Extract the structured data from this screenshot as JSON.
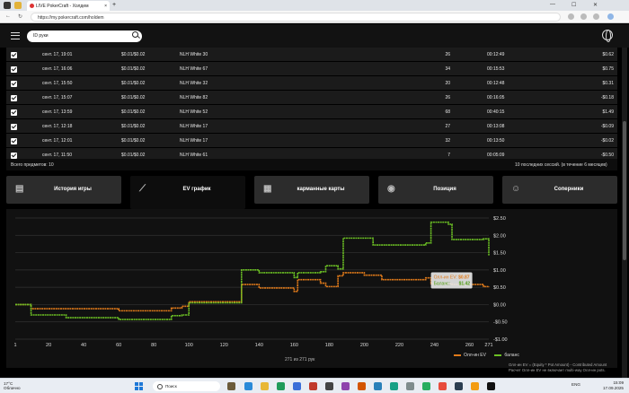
{
  "browser": {
    "tab_title": "LIVE PokerCraft - Холдем",
    "url": "https://my.pokercraft.com/holdem",
    "new_tab": "+",
    "close": "×",
    "minimize": "—",
    "maximize": "☐",
    "win_close": "✕",
    "back": "←",
    "reload": "↻"
  },
  "appbar": {
    "search_placeholder": "ID руки"
  },
  "sessions": {
    "rows": [
      {
        "date": "сент. 17, 19:01",
        "stakes": "$0.01/$0.02",
        "table": "NLH White 30",
        "hands": "26",
        "duration": "00:12:49",
        "result": "$0.62"
      },
      {
        "date": "сент. 17, 16:06",
        "stakes": "$0.01/$0.02",
        "table": "NLH White 67",
        "hands": "34",
        "duration": "00:15:53",
        "result": "$0.75"
      },
      {
        "date": "сент. 17, 15:50",
        "stakes": "$0.01/$0.02",
        "table": "NLH White 32",
        "hands": "20",
        "duration": "00:12:48",
        "result": "$0.31"
      },
      {
        "date": "сент. 17, 15:07",
        "stakes": "$0.01/$0.02",
        "table": "NLH White 82",
        "hands": "26",
        "duration": "00:16:05",
        "result": "-$0.18"
      },
      {
        "date": "сент. 17, 13:59",
        "stakes": "$0.01/$0.02",
        "table": "NLH White 52",
        "hands": "68",
        "duration": "00:40:15",
        "result": "$1.49"
      },
      {
        "date": "сент. 17, 12:18",
        "stakes": "$0.01/$0.02",
        "table": "NLH White 17",
        "hands": "27",
        "duration": "00:13:08",
        "result": "-$0.09"
      },
      {
        "date": "сент. 17, 12:01",
        "stakes": "$0.01/$0.02",
        "table": "NLH White 17",
        "hands": "32",
        "duration": "00:13:50",
        "result": "-$0.02"
      },
      {
        "date": "сент. 17, 11:50",
        "stakes": "$0.01/$0.02",
        "table": "NLH White 61",
        "hands": "7",
        "duration": "00:05:09",
        "result": "-$0.50"
      }
    ],
    "total": "Всего предметов: 10",
    "last_sessions": "10 последних сессий. (в течение 6 месяцев)"
  },
  "tabs": [
    {
      "label": "История игры",
      "icon": "history-icon",
      "active": false
    },
    {
      "label": "EV график",
      "icon": "chart-icon",
      "active": true
    },
    {
      "label": "карманные карты",
      "icon": "grid-icon",
      "active": false
    },
    {
      "label": "Позиция",
      "icon": "position-icon",
      "active": false
    },
    {
      "label": "Соперники",
      "icon": "opponent-icon",
      "active": false
    }
  ],
  "chart_data": {
    "type": "line",
    "x_ticks": [
      "1",
      "20",
      "40",
      "60",
      "80",
      "100",
      "120",
      "140",
      "160",
      "180",
      "200",
      "220",
      "240",
      "260",
      "271"
    ],
    "y_ticks": [
      "$2.50",
      "$2.00",
      "$1.50",
      "$1.00",
      "$0.50",
      "$0.00",
      "-$0.50",
      "-$1.00"
    ],
    "xlim": [
      1,
      271
    ],
    "ylim": [
      -1.0,
      2.5
    ],
    "grid": true,
    "legend_position": "bottom-right",
    "tooltip": {
      "ev_label": "Олл-ин EV:",
      "ev_value": "$0.87",
      "bal_label": "Баланс:",
      "bal_value": "$1.42"
    },
    "series": [
      {
        "name": "Олл-ин EV",
        "color": "#e07a1a",
        "x": [
          1,
          8,
          10,
          30,
          60,
          90,
          96,
          100,
          128,
          130,
          140,
          160,
          162,
          175,
          178,
          185,
          188,
          200,
          210,
          235,
          238,
          250,
          268,
          271
        ],
        "y": [
          0.0,
          0.0,
          -0.12,
          -0.12,
          -0.18,
          -0.1,
          -0.05,
          0.08,
          0.08,
          0.58,
          0.48,
          0.38,
          0.72,
          0.62,
          0.52,
          0.83,
          0.92,
          0.85,
          0.72,
          0.77,
          0.6,
          0.58,
          0.52,
          0.5
        ]
      },
      {
        "name": "баланс",
        "color": "#6cc024",
        "x": [
          1,
          8,
          10,
          30,
          60,
          90,
          96,
          100,
          128,
          130,
          140,
          160,
          162,
          175,
          178,
          185,
          188,
          205,
          235,
          238,
          248,
          250,
          268,
          271
        ],
        "y": [
          0.0,
          0.0,
          -0.3,
          -0.38,
          -0.43,
          -0.32,
          -0.3,
          0.05,
          0.05,
          1.0,
          0.92,
          0.78,
          0.92,
          0.95,
          1.12,
          1.03,
          1.92,
          1.72,
          1.78,
          2.38,
          2.32,
          1.88,
          1.9,
          1.42
        ]
      }
    ]
  },
  "chart_footer": {
    "pager": "271 из 271 рук",
    "note1": "Олл-ин EV = (Equity * Pot Amount) - Contributed Amount",
    "note2": "Расчет Олл-ин EV не включает multi-way Олл-ин pots."
  },
  "taskbar": {
    "weather_temp": "17°C",
    "weather_desc": "Облачно",
    "search": "Поиск",
    "lang": "ENG",
    "time": "15:09",
    "date": "17.09.2025"
  }
}
